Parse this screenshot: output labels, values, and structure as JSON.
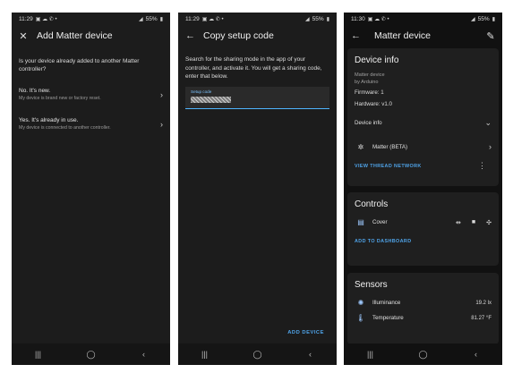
{
  "screens": [
    {
      "status": {
        "time": "11:29",
        "battery": "55%"
      },
      "appbar": {
        "title": "Add Matter device"
      },
      "question": "Is your device already added to another Matter controller?",
      "options": [
        {
          "title": "No. It's new.",
          "desc": "My device is brand new or factory reset."
        },
        {
          "title": "Yes. It's already in use.",
          "desc": "My device is connected to another controller."
        }
      ]
    },
    {
      "status": {
        "time": "11:29",
        "battery": "55%"
      },
      "appbar": {
        "title": "Copy setup code"
      },
      "instructions": "Search for the sharing mode in the app of your controller, and activate it. You will get a sharing code, enter that below.",
      "field_label": "Setup code",
      "action": "ADD DEVICE"
    },
    {
      "status": {
        "time": "11:30",
        "battery": "55%"
      },
      "appbar": {
        "title": "Matter device"
      },
      "device_info": {
        "title": "Device info",
        "model": "Matter device",
        "manufacturer": "by Arduino",
        "firmware": "Firmware: 1",
        "hardware": "Hardware: v1.0",
        "section": "Device info",
        "integration": "Matter (BETA)",
        "link": "VIEW THREAD NETWORK"
      },
      "controls": {
        "title": "Controls",
        "entity": "Cover",
        "link": "ADD TO DASHBOARD"
      },
      "sensors": {
        "title": "Sensors",
        "items": [
          {
            "name": "Illuminance",
            "value": "19.2 lx"
          },
          {
            "name": "Temperature",
            "value": "81.27 °F"
          }
        ]
      }
    }
  ],
  "colors": {
    "accent": "#4fa3e8",
    "background": "#1c1c1c"
  }
}
